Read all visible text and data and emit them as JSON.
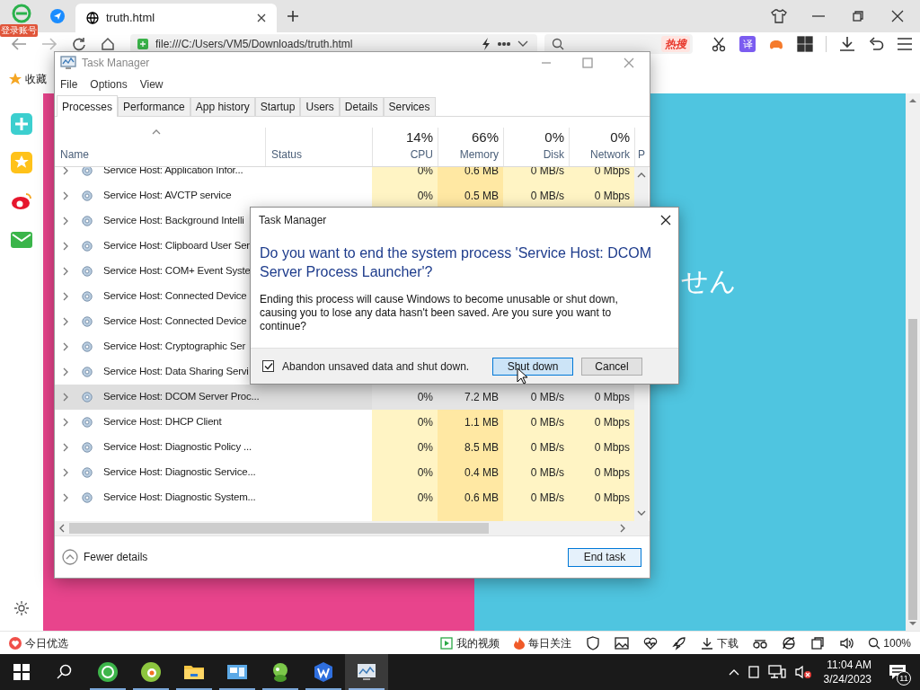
{
  "browser": {
    "account_badge": "登录账号",
    "tab": {
      "title": "truth.html"
    },
    "address": "file:///C:/Users/VM5/Downloads/truth.html",
    "hot_badge": "热搜",
    "translate_button": "译",
    "bookmarks": [
      {
        "label": "收藏"
      }
    ],
    "status_left": "今日优选",
    "status_items": [
      {
        "kind": "video",
        "label": "我的视频"
      },
      {
        "kind": "follow",
        "label": "每日关注"
      },
      {
        "kind": "download",
        "label": "下载"
      }
    ],
    "zoom": "100%"
  },
  "page": {
    "text": "せん"
  },
  "task_manager": {
    "title": "Task Manager",
    "menu": [
      "File",
      "Options",
      "View"
    ],
    "tabs": [
      {
        "label": "Processes",
        "selected": true
      },
      {
        "label": "Performance",
        "selected": false
      },
      {
        "label": "App history",
        "selected": false
      },
      {
        "label": "Startup",
        "selected": false
      },
      {
        "label": "Users",
        "selected": false
      },
      {
        "label": "Details",
        "selected": false
      },
      {
        "label": "Services",
        "selected": false
      }
    ],
    "columns": [
      {
        "label": "Name"
      },
      {
        "label": "Status"
      },
      {
        "percent": "14%",
        "label": "CPU"
      },
      {
        "percent": "66%",
        "label": "Memory"
      },
      {
        "percent": "0%",
        "label": "Disk"
      },
      {
        "percent": "0%",
        "label": "Network"
      },
      {
        "label": "P"
      }
    ],
    "rows": [
      {
        "name": "Service Host: Application Infor...",
        "cpu": "0%",
        "memory": "0.6 MB",
        "disk": "0 MB/s",
        "network": "0 Mbps",
        "selected": false
      },
      {
        "name": "Service Host: AVCTP service",
        "cpu": "0%",
        "memory": "0.5 MB",
        "disk": "0 MB/s",
        "network": "0 Mbps",
        "selected": false
      },
      {
        "name": "Service Host: Background Intelli",
        "selected": false
      },
      {
        "name": "Service Host: Clipboard User Ser",
        "selected": false
      },
      {
        "name": "Service Host: COM+ Event Syste",
        "selected": false
      },
      {
        "name": "Service Host: Connected Device",
        "selected": false
      },
      {
        "name": "Service Host: Connected Device",
        "selected": false
      },
      {
        "name": "Service Host: Cryptographic Ser",
        "selected": false
      },
      {
        "name": "Service Host: Data Sharing Servi",
        "selected": false
      },
      {
        "name": "Service Host: DCOM Server Proc...",
        "cpu": "0%",
        "memory": "7.2 MB",
        "disk": "0 MB/s",
        "network": "0 Mbps",
        "selected": true
      },
      {
        "name": "Service Host: DHCP Client",
        "cpu": "0%",
        "memory": "1.1 MB",
        "disk": "0 MB/s",
        "network": "0 Mbps",
        "selected": false
      },
      {
        "name": "Service Host: Diagnostic Policy ...",
        "cpu": "0%",
        "memory": "8.5 MB",
        "disk": "0 MB/s",
        "network": "0 Mbps",
        "selected": false
      },
      {
        "name": "Service Host: Diagnostic Service...",
        "cpu": "0%",
        "memory": "0.4 MB",
        "disk": "0 MB/s",
        "network": "0 Mbps",
        "selected": false
      },
      {
        "name": "Service Host: Diagnostic System...",
        "cpu": "0%",
        "memory": "0.6 MB",
        "disk": "0 MB/s",
        "network": "0 Mbps",
        "selected": false
      }
    ],
    "fewer_details": "Fewer details",
    "end_task": "End task"
  },
  "dialog": {
    "title": "Task Manager",
    "heading": "Do you want to end the system process 'Service Host: DCOM Server Process Launcher'?",
    "message": "Ending this process will cause Windows to become unusable or shut down, causing you to lose any data hasn't been saved. Are you sure you want to continue?",
    "checkbox": {
      "label": "Abandon unsaved data and shut down.",
      "checked": true
    },
    "buttons": [
      {
        "label": "Shut down",
        "highlighted": true
      },
      {
        "label": "Cancel",
        "highlighted": false
      }
    ]
  },
  "taskbar": {
    "time": "11:04 AM",
    "date": "3/24/2023",
    "notifications": "11"
  }
}
